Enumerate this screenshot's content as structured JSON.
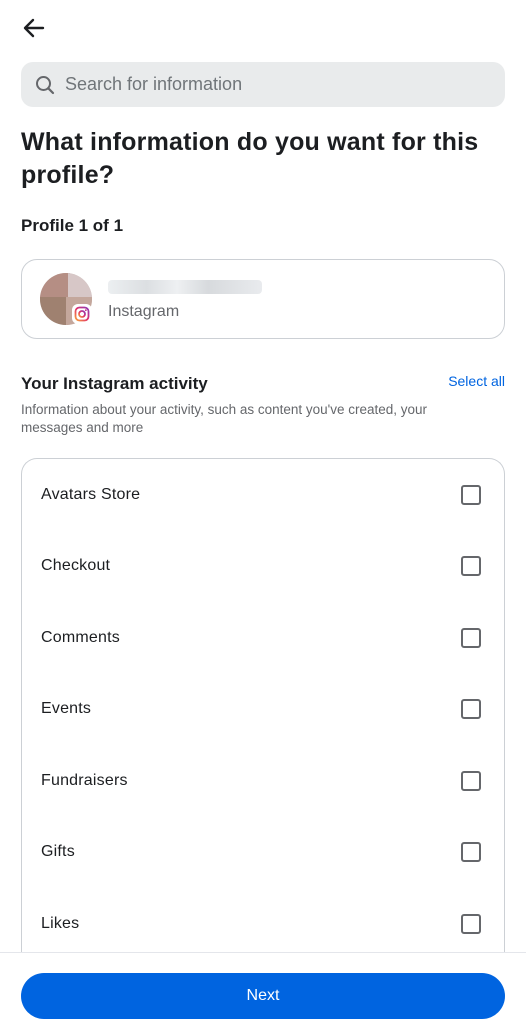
{
  "header": {
    "back_icon": "arrow-left-icon"
  },
  "search": {
    "placeholder": "Search for information",
    "value": "",
    "icon": "search-icon"
  },
  "title": "What information do you want for this profile?",
  "profile_count": "Profile 1 of 1",
  "profile": {
    "platform": "Instagram",
    "badge_icon": "instagram-icon"
  },
  "section": {
    "title": "Your Instagram activity",
    "select_all": "Select all",
    "description": "Information about your activity, such as content you've created, your messages and more"
  },
  "items": [
    {
      "label": "Avatars Store",
      "checked": false
    },
    {
      "label": "Checkout",
      "checked": false
    },
    {
      "label": "Comments",
      "checked": false
    },
    {
      "label": "Events",
      "checked": false
    },
    {
      "label": "Fundraisers",
      "checked": false
    },
    {
      "label": "Gifts",
      "checked": false
    },
    {
      "label": "Likes",
      "checked": false
    }
  ],
  "next_label": "Next",
  "colors": {
    "accent": "#0064e0",
    "checkbox_border": "#65676b",
    "card_border": "#ccd0d5"
  }
}
